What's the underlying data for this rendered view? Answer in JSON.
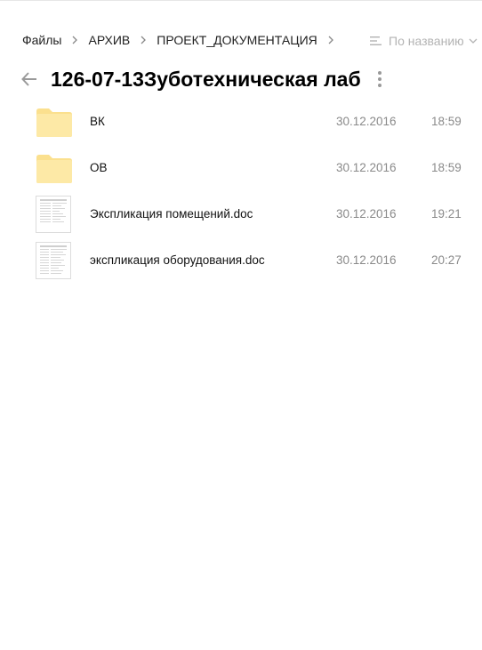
{
  "breadcrumb": {
    "items": [
      {
        "label": "Файлы"
      },
      {
        "label": "АРХИВ"
      },
      {
        "label": "ПРОЕКТ_ДОКУМЕНТАЦИЯ"
      }
    ]
  },
  "sort": {
    "label": "По названию"
  },
  "header": {
    "title": "126-07-13Зуботехническая лаб"
  },
  "files": [
    {
      "name": "ВК",
      "date": "30.12.2016",
      "time": "18:59",
      "type": "folder",
      "icon": "folder-icon"
    },
    {
      "name": "ОВ",
      "date": "30.12.2016",
      "time": "18:59",
      "type": "folder",
      "icon": "folder-icon"
    },
    {
      "name": "Экспликация помещений.doc",
      "date": "30.12.2016",
      "time": "19:21",
      "type": "doc",
      "icon": "document-thumbnail"
    },
    {
      "name": "экспликация оборудования.doc",
      "date": "30.12.2016",
      "time": "20:27",
      "type": "doc",
      "icon": "document-thumbnail"
    }
  ],
  "colors": {
    "folder_fill": "#fde9a6",
    "folder_tab": "#fbe08e",
    "muted_text": "#8a8a8a",
    "sort_text": "#b3b3b3"
  }
}
